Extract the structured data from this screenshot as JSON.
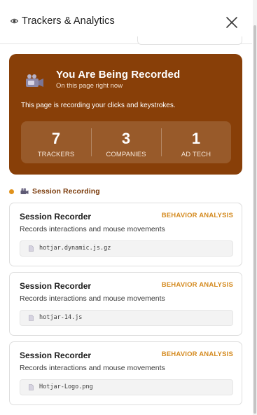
{
  "header": {
    "title": "Trackers & Analytics",
    "title_icon": "eye-icon",
    "close_icon": "close-icon"
  },
  "alert": {
    "icon": "camera-icon",
    "title": "You Are Being Recorded",
    "subtitle": "On this page right now",
    "description": "This page is recording your clicks and keystrokes.",
    "background_color": "#883f08",
    "stats": [
      {
        "value": "7",
        "label": "TRACKERS"
      },
      {
        "value": "3",
        "label": "COMPANIES"
      },
      {
        "value": "1",
        "label": "AD TECH"
      }
    ]
  },
  "section": {
    "icon": "camera-icon",
    "title": "Session Recording",
    "dot_color": "#e0921c"
  },
  "trackers": [
    {
      "name": "Session Recorder",
      "category": "BEHAVIOR ANALYSIS",
      "description": "Records interactions and mouse movements",
      "file": "hotjar.dynamic.js.gz"
    },
    {
      "name": "Session Recorder",
      "category": "BEHAVIOR ANALYSIS",
      "description": "Records interactions and mouse movements",
      "file": "hotjar-14.js"
    },
    {
      "name": "Session Recorder",
      "category": "BEHAVIOR ANALYSIS",
      "description": "Records interactions and mouse movements",
      "file": "Hotjar-Logo.png"
    }
  ],
  "colors": {
    "accent": "#d48a1f",
    "section_title": "#7a3a0a"
  }
}
